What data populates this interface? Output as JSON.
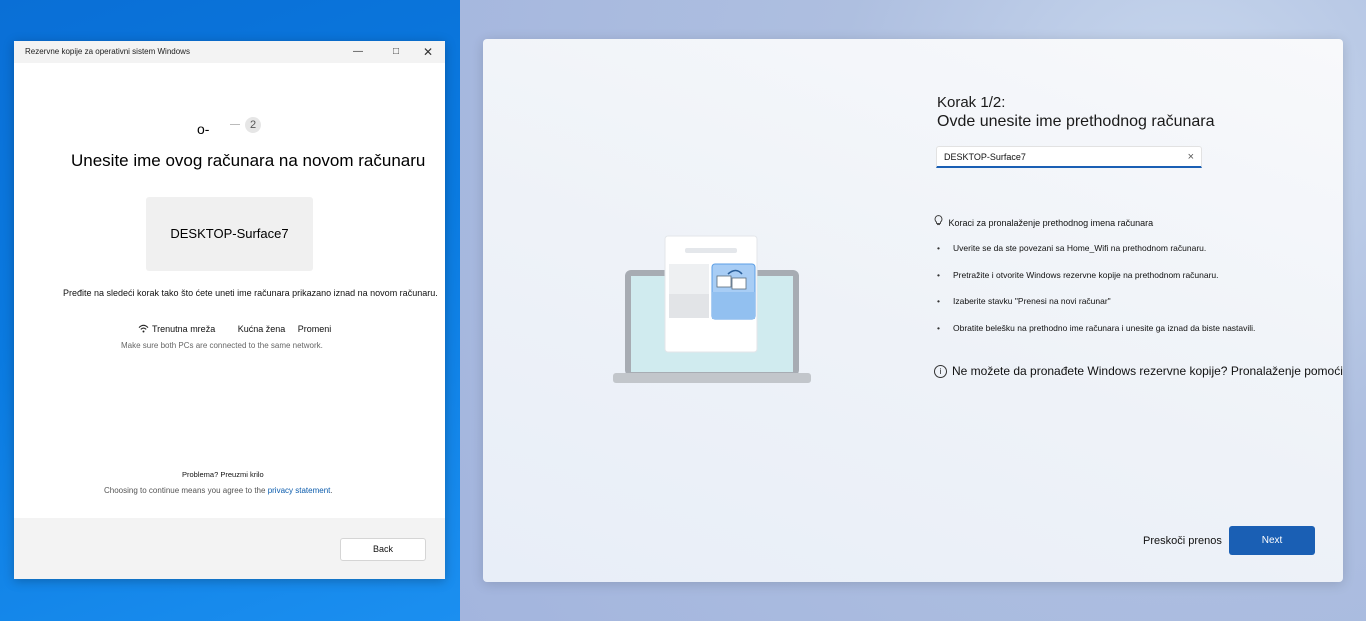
{
  "backup_window": {
    "title": "Rezervne kopije za operativni sistem Windows",
    "step_current": "o-",
    "step_next": "2",
    "heading": "Unesite ime ovog računara na novom računaru",
    "pc_name": "DESKTOP-Surface7",
    "instruction": "Pređite na sledeći korak tako što ćete uneti ime računara prikazano iznad na novom računaru.",
    "network": {
      "label": "Trenutna mreža",
      "name": "Kućna žena",
      "change": "Promeni",
      "note": "Make sure both PCs are connected to the same network."
    },
    "problem_text": "Problema? Preuzmi krilo",
    "consent_text": "Choosing to continue means you agree to the",
    "privacy_link": "privacy statement",
    "consent_end": ".",
    "back_label": "Back"
  },
  "transfer_dialog": {
    "step_label": "Korak 1/2:",
    "heading": "Ovde unesite ime prethodnog računara",
    "input_value": "DESKTOP-Surface7",
    "clear_glyph": "×",
    "tips_header": "Koraci za pronalaženje prethodnog imena računara",
    "tips": [
      "Uverite se da ste povezani sa Home_Wifi na prethodnom računaru.",
      "Pretražite i otvorite Windows rezervne kopije na prethodnom računaru.",
      "Izaberite stavku \"Prenesi na novi računar\"",
      "Obratite belešku na prethodno ime računara i unesite ga iznad da biste nastavili."
    ],
    "help_text": "Ne možete da pronađete Windows rezervne kopije? Pronalaženje pomoći",
    "skip_label": "Preskoči prenos",
    "next_label": "Next"
  },
  "colors": {
    "accent": "#1a5fb4",
    "desktop_blue": "#0a7ae0"
  },
  "icons": [
    "minimize-icon",
    "maximize-icon",
    "close-icon",
    "wifi-icon",
    "clear-icon",
    "lightbulb-icon",
    "info-icon",
    "laptop-illustration"
  ]
}
